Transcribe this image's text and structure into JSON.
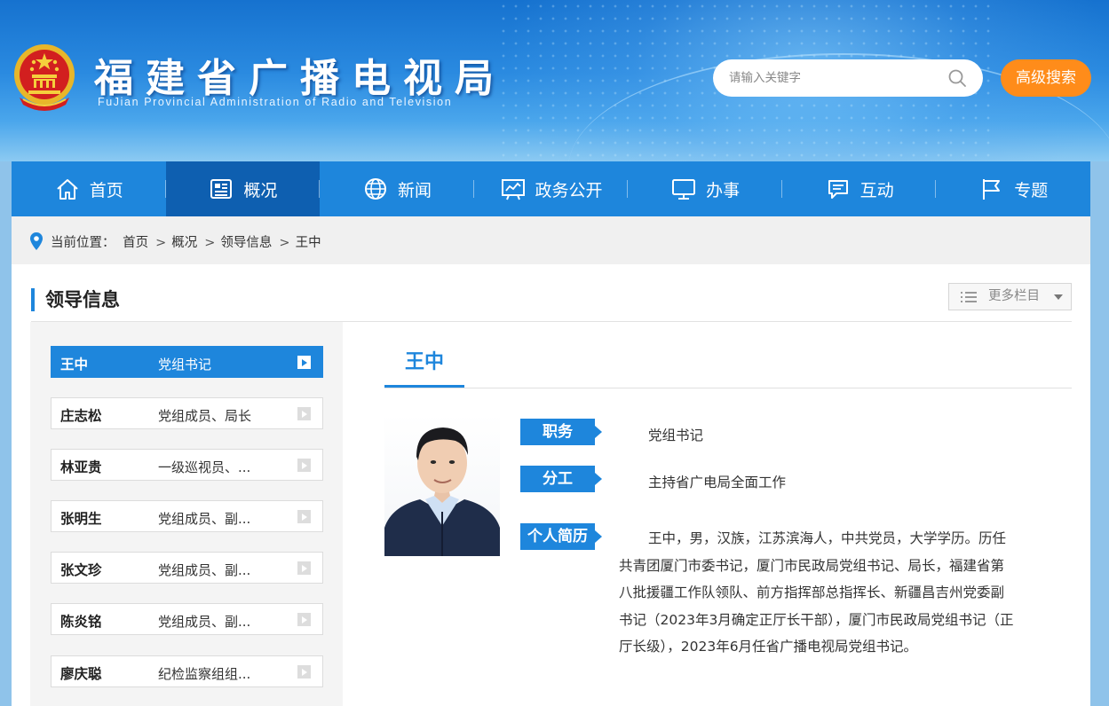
{
  "header": {
    "title": "福建省广播电视局",
    "subtitle": "FuJian Provincial Administration of Radio and Television",
    "search_placeholder": "请输入关键字",
    "advanced_search_label": "高级搜索"
  },
  "nav": {
    "items": [
      {
        "label": "首页",
        "icon": "home-icon"
      },
      {
        "label": "概况",
        "icon": "overview-icon"
      },
      {
        "label": "新闻",
        "icon": "globe-icon"
      },
      {
        "label": "政务公开",
        "icon": "board-icon"
      },
      {
        "label": "办事",
        "icon": "monitor-icon"
      },
      {
        "label": "互动",
        "icon": "chat-icon"
      },
      {
        "label": "专题",
        "icon": "flag-icon"
      }
    ],
    "active_index": 1
  },
  "breadcrumb": {
    "prefix": "当前位置：",
    "items": [
      "首页",
      "概况",
      "领导信息",
      "王中"
    ],
    "separator": ">"
  },
  "section": {
    "title": "领导信息",
    "more_label": "更多栏目"
  },
  "leaders": [
    {
      "name": "王中",
      "position": "党组书记"
    },
    {
      "name": "庄志松",
      "position": "党组成员、局长"
    },
    {
      "name": "林亚贵",
      "position": "一级巡视员、..."
    },
    {
      "name": "张明生",
      "position": "党组成员、副..."
    },
    {
      "name": "张文珍",
      "position": "党组成员、副..."
    },
    {
      "name": "陈炎铭",
      "position": "党组成员、副..."
    },
    {
      "name": "廖庆聪",
      "position": "纪检监察组组..."
    }
  ],
  "profile": {
    "name": "王中",
    "duty_label": "职务",
    "duty": "党组书记",
    "division_label": "分工",
    "division": "主持省广电局全面工作",
    "bio_label": "个人简历",
    "bio": "王中，男，汉族，江苏滨海人，中共党员，大学学历。历任共青团厦门市委书记，厦门市民政局党组书记、局长，福建省第八批援疆工作队领队、前方指挥部总指挥长、新疆昌吉州党委副书记（2023年3月确定正厅长干部），厦门市民政局党组书记（正厅长级），2023年6月任省广播电视局党组书记。"
  },
  "colors": {
    "primary": "#1e86dc",
    "nav_active": "#0e5fb0",
    "advanced_search": "#ff8c1a"
  }
}
